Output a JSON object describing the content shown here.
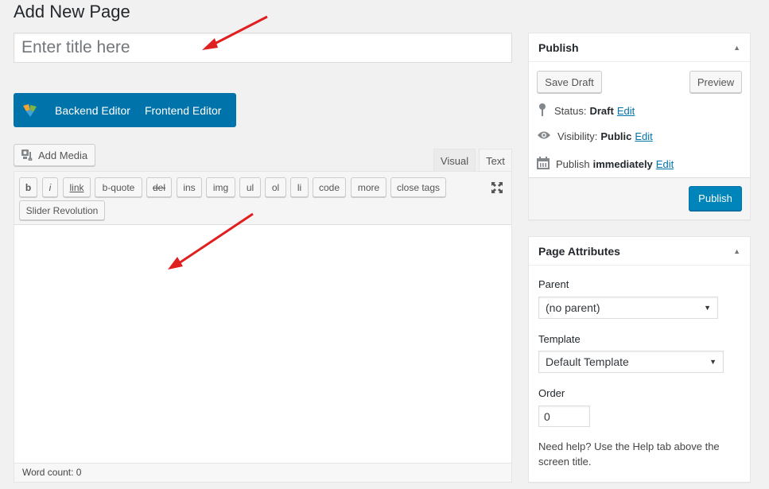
{
  "page": {
    "title": "Add New Page"
  },
  "title_field": {
    "placeholder": "Enter title here",
    "value": ""
  },
  "composer": {
    "logo_icon": "visual-composer-logo-icon",
    "backend_label": "Backend Editor",
    "frontend_label": "Frontend Editor",
    "accent": "#0073aa"
  },
  "editor": {
    "add_media_label": "Add Media",
    "add_media_icon": "media-icon",
    "tabs": [
      {
        "label": "Visual",
        "active": false
      },
      {
        "label": "Text",
        "active": true
      }
    ],
    "quicktags": [
      "b",
      "i",
      "link",
      "b-quote",
      "del",
      "ins",
      "img",
      "ul",
      "ol",
      "li",
      "code",
      "more",
      "close tags"
    ],
    "extra_button": "Slider Revolution",
    "fullscreen_icon": "fullscreen-icon",
    "content": "",
    "word_count": "Word count: 0"
  },
  "publish": {
    "title": "Publish",
    "save_draft": "Save Draft",
    "preview": "Preview",
    "status_label": "Status:",
    "status_value": "Draft",
    "visibility_label": "Visibility:",
    "visibility_value": "Public",
    "schedule_label": "Publish",
    "schedule_value": "immediately",
    "edit_label": "Edit",
    "publish_button": "Publish",
    "primary_color": "#0085ba"
  },
  "page_attributes": {
    "title": "Page Attributes",
    "parent_label": "Parent",
    "parent_value": "(no parent)",
    "template_label": "Template",
    "template_value": "Default Template",
    "order_label": "Order",
    "order_value": "0",
    "help_text": "Need help? Use the Help tab above the screen title."
  },
  "annotations": {
    "arrow_color": "#e02020"
  }
}
